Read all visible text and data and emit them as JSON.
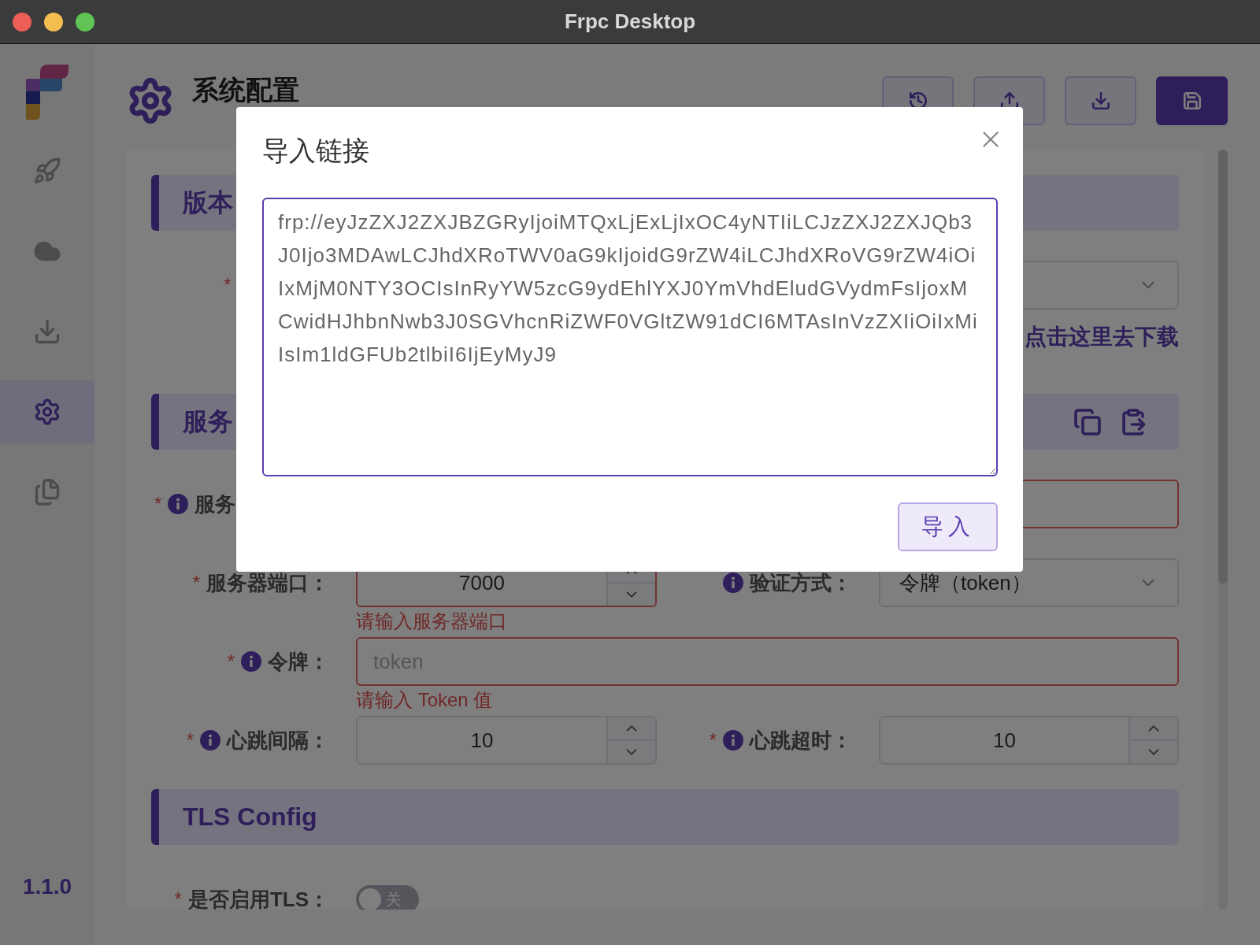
{
  "window": {
    "title": "Frpc Desktop"
  },
  "sidebar": {
    "items": [
      {
        "kind": "rocket",
        "selected": false
      },
      {
        "kind": "cloud",
        "selected": false
      },
      {
        "kind": "download",
        "selected": false
      },
      {
        "kind": "gear",
        "selected": true
      },
      {
        "kind": "files",
        "selected": false
      }
    ],
    "version": "1.1.0"
  },
  "header": {
    "title": "系统配置",
    "actions": [
      {
        "kind": "history",
        "primary": false
      },
      {
        "kind": "upload",
        "primary": false
      },
      {
        "kind": "download",
        "primary": false
      },
      {
        "kind": "save",
        "primary": true
      }
    ]
  },
  "version_section": {
    "title": "版本",
    "required_mark": "*",
    "download_link": "点击这里去下载"
  },
  "server_section": {
    "title": "服务",
    "tools": [
      {
        "kind": "copy"
      },
      {
        "kind": "paste"
      }
    ],
    "fields": [
      {
        "kind": "address_text",
        "label": "服务",
        "required_mark": "*",
        "info": true,
        "invalid": true
      },
      {
        "kind": "number",
        "label": "服务器端口：",
        "required_mark": "*",
        "info": false,
        "invalid": true,
        "value": "7000",
        "error": "请输入服务器端口"
      },
      {
        "kind": "select",
        "label": "验证方式：",
        "info": true,
        "invalid": false,
        "value": "令牌（token）"
      },
      {
        "kind": "text_full",
        "label": "令牌：",
        "required_mark": "*",
        "info": true,
        "invalid": true,
        "placeholder": "token",
        "error": "请输入 Token 值"
      },
      {
        "kind": "number",
        "label": "心跳间隔：",
        "required_mark": "*",
        "info": true,
        "invalid": false,
        "value": "10"
      },
      {
        "kind": "number",
        "label": "心跳超时：",
        "required_mark": "*",
        "info": true,
        "invalid": false,
        "value": "10"
      }
    ]
  },
  "tls_section": {
    "title": "TLS Config",
    "fields": [
      {
        "kind": "switch",
        "label": "是否启用TLS：",
        "required_mark": "*",
        "info": false,
        "on": false,
        "off_text": "关"
      }
    ]
  },
  "dialog": {
    "title": "导入链接",
    "value": "frp://eyJzZXJ2ZXJBZGRyIjoiMTQxLjExLjIxOC4yNTIiLCJzZXJ2ZXJQb3J0Ijo3MDAwLCJhdXRoTWV0aG9kIjoidG9rZW4iLCJhdXRoVG9rZW4iOiIxMjM0NTY3OCIsInRyYW5zcG9ydEhlYXJ0YmVhdEludGVydmFsIjoxMCwidHJhbnNwb3J0SGVhcnRiZWF0VGltZW91dCI6MTAsInVzZXIiOiIxMiIsIm1ldGFUb2tlbiI6IjEyMyJ9",
    "button": "导入"
  }
}
